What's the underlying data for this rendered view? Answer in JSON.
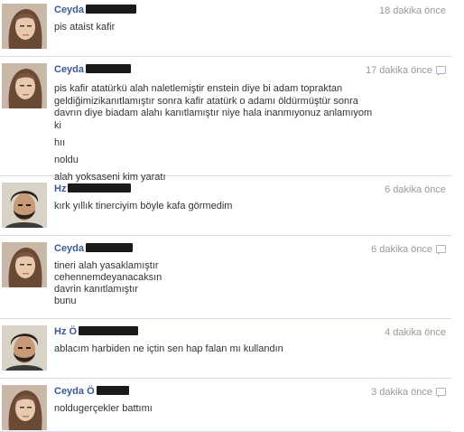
{
  "messages": [
    {
      "sender": "Ceyda",
      "time": "18 dakika önce",
      "lines": [
        "pis ataist kafir"
      ]
    },
    {
      "sender": "Ceyda",
      "time": "17 dakika önce",
      "lines": [
        "pis kafir atatürkü alah naletlemiştir enstein diye bi adam topraktan geldiğimizikanıtlamıştır sonra kafir atatürk o adamı öldürmüştür sonra davrın diye biadam alahı kanıtlamıştır niye hala inanmıyonuz anlamıyom ki",
        "hıı",
        "noldu",
        "alah yoksaseni kim yaratı"
      ]
    },
    {
      "sender": "Hz",
      "time": "6 dakika önce",
      "lines": [
        "kırk yıllık tinerciyim böyle kafa görmedim"
      ]
    },
    {
      "sender": "Ceyda",
      "time": "6 dakika önce",
      "lines": [
        "tineri alah yasaklamıştır",
        "cehennemdeyanacaksın",
        "davrin kanıtlamıştır",
        "bunu"
      ]
    },
    {
      "sender": "Hz Ö",
      "time": "4 dakika önce",
      "lines": [
        "ablacım harbiden ne içtin sen hap falan mı kullandın"
      ]
    },
    {
      "sender": "Ceyda Ö",
      "time": "3 dakika önce",
      "lines": [
        "noldugerçekler battımı"
      ]
    }
  ],
  "colors": {
    "name": "#3b5998",
    "time": "#999999",
    "divider": "#d8dfea",
    "text": "#333333"
  },
  "icons": {
    "reply": "reply-icon",
    "female_avatar": "avatar-photo-woman",
    "male_avatar": "avatar-photo-man"
  }
}
